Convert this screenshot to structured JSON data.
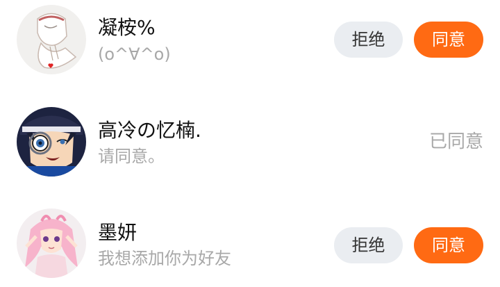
{
  "requests": [
    {
      "name": "凝桉%",
      "message": "(o^∀^o)",
      "avatar": "anime-avatar-white-hair",
      "reject_label": "拒绝",
      "accept_label": "同意"
    },
    {
      "name": "高冷の忆楠.",
      "message": "请同意。",
      "avatar": "anime-avatar-monocle-boy",
      "status_label": "已同意"
    },
    {
      "name": "墨妍",
      "message": "我想添加你为好友",
      "avatar": "anime-avatar-pink-hair-girl",
      "reject_label": "拒绝",
      "accept_label": "同意"
    }
  ],
  "colors": {
    "accent": "#ff6a13",
    "reject_bg": "#eaedf1",
    "muted_text": "#a8a8a8"
  }
}
